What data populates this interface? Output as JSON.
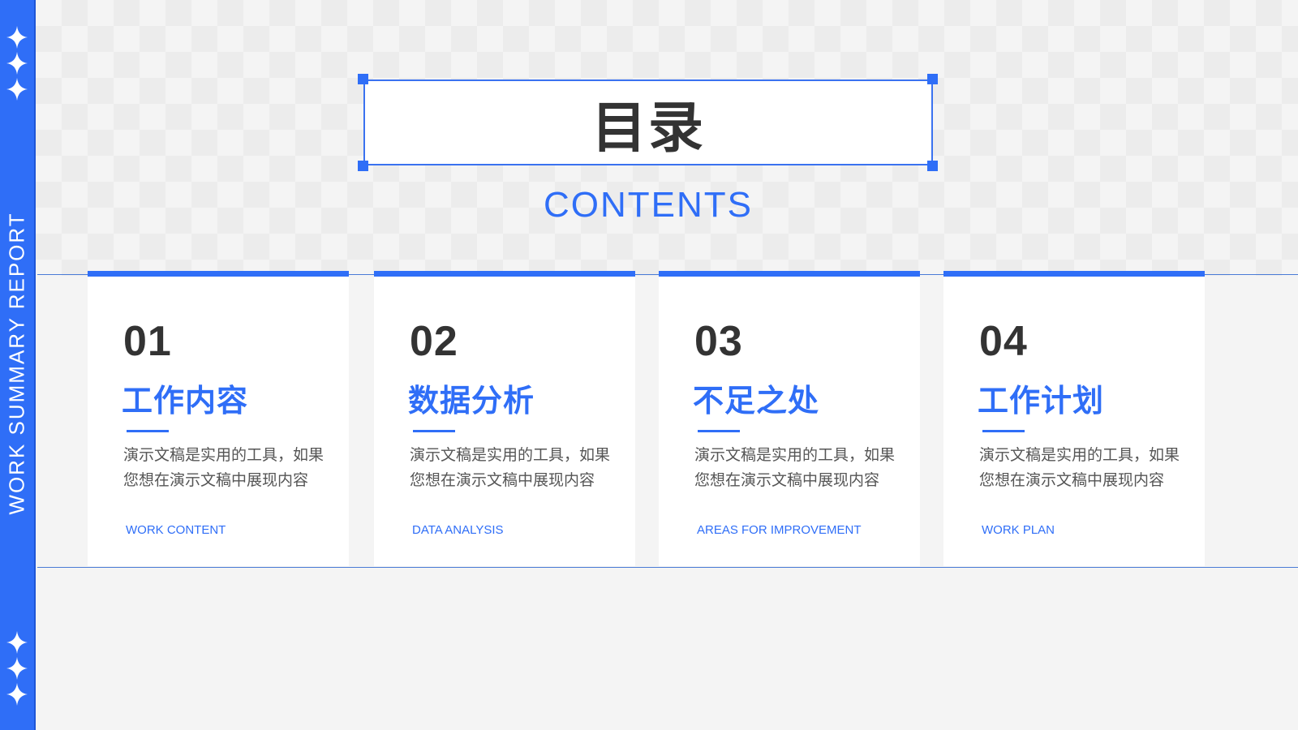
{
  "sidebar": {
    "vertical_text": "WORK SUMMARY REPORT",
    "top_icons": [
      "sparkle-icon",
      "sparkle-icon",
      "sparkle-icon"
    ],
    "bottom_icons": [
      "sparkle-icon",
      "sparkle-icon",
      "sparkle-icon"
    ]
  },
  "header": {
    "title": "目录",
    "subtitle": "CONTENTS"
  },
  "cards": [
    {
      "number": "01",
      "title": "工作内容",
      "description_line1": "演示文稿是实用的工具，如果",
      "description_line2": "您想在演示文稿中展现内容",
      "english": "WORK CONTENT"
    },
    {
      "number": "02",
      "title": "数据分析",
      "description_line1": "演示文稿是实用的工具，如果",
      "description_line2": "您想在演示文稿中展现内容",
      "english": "DATA ANALYSIS"
    },
    {
      "number": "03",
      "title": "不足之处",
      "description_line1": "演示文稿是实用的工具，如果",
      "description_line2": "您想在演示文稿中展现内容",
      "english": "AREAS FOR IMPROVEMENT"
    },
    {
      "number": "04",
      "title": "工作计划",
      "description_line1": "演示文稿是实用的工具，如果",
      "description_line2": "您想在演示文稿中展现内容",
      "english": "WORK PLAN"
    }
  ],
  "colors": {
    "accent": "#2f6ef7",
    "text_dark": "#333333",
    "text_body": "#555555",
    "background": "#f4f4f4"
  }
}
